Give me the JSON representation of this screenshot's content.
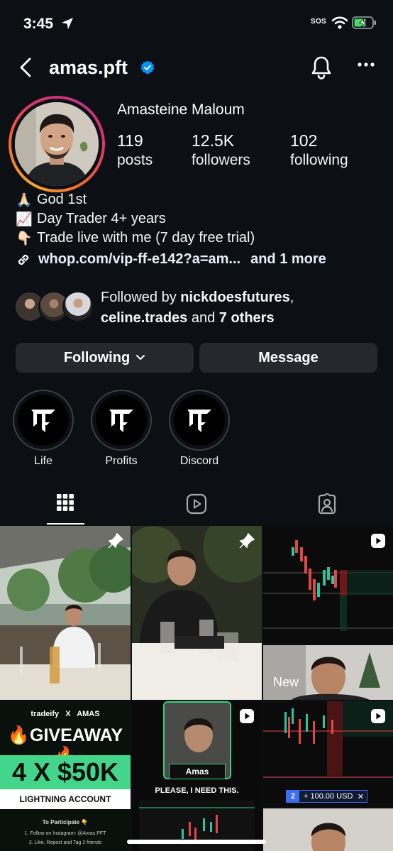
{
  "status_bar": {
    "time": "3:45",
    "sos": "SOS"
  },
  "header": {
    "username": "amas.pft"
  },
  "profile": {
    "full_name": "Amasteine Maloum",
    "stats": [
      {
        "value": "119",
        "label": "posts"
      },
      {
        "value": "12.5K",
        "label": "followers"
      },
      {
        "value": "102",
        "label": "following"
      }
    ],
    "bio": [
      {
        "emoji": "🙏🏻",
        "text": "God 1st"
      },
      {
        "emoji": "📈",
        "text": "Day Trader 4+ years"
      },
      {
        "emoji": "👇🏻",
        "text": "Trade live with me (7 day free trial)"
      }
    ],
    "link": "whop.com/vip-ff-e142?a=am...",
    "link_more": "and 1 more"
  },
  "followed_by": {
    "prefix": "Followed by ",
    "user1": "nickdoesfutures",
    "sep": ",",
    "user2": "celine.trades",
    "and": " and ",
    "others": "7 others"
  },
  "actions": {
    "following_label": "Following",
    "message_label": "Message"
  },
  "highlights": [
    {
      "label": "Life"
    },
    {
      "label": "Profits"
    },
    {
      "label": "Discord"
    }
  ],
  "grid": {
    "new_label": "New",
    "giveaway": {
      "brand": "tradeify",
      "x": "X",
      "partner": "AMAS",
      "title": "GIVEAWAY",
      "amount": "4 X $50K",
      "subtitle": "LIGHTNING ACCOUNT",
      "participate": "To Participate 👇",
      "step1": "1. Follow on Instagram: @Amas.PFT",
      "step2": "2. Like, Repost and Tag 2 friends"
    },
    "reel_name": "Amas",
    "reel_caption": "PLEASE, I NEED THIS.",
    "order_qty": "2",
    "order_value": "+ 100.00 USD",
    "order_close": "✕"
  },
  "colors": {
    "background": "#0c1014",
    "button": "#25292e",
    "verified": "#0095f6"
  }
}
